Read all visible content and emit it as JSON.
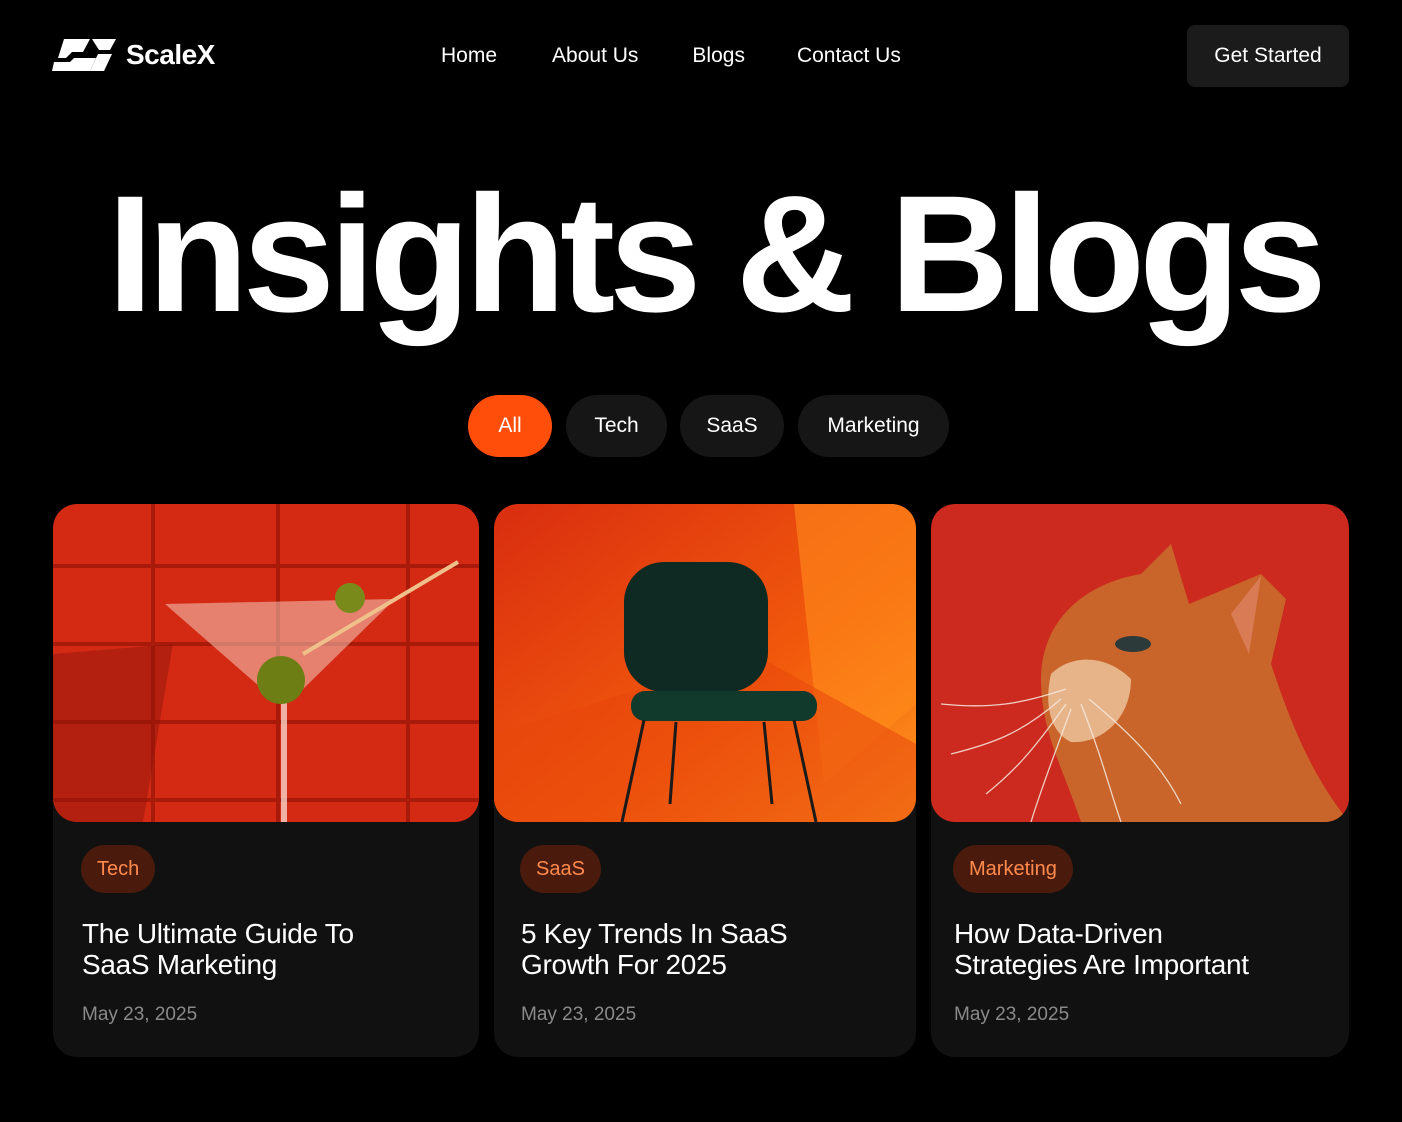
{
  "brand": {
    "name": "ScaleX",
    "logo_icon": "scalex-logo-icon"
  },
  "nav": {
    "items": [
      {
        "label": "Home"
      },
      {
        "label": "About Us"
      },
      {
        "label": "Blogs"
      },
      {
        "label": "Contact Us"
      }
    ],
    "cta_label": "Get Started"
  },
  "hero": {
    "title": "Insights & Blogs"
  },
  "filters": {
    "items": [
      {
        "label": "All",
        "active": true
      },
      {
        "label": "Tech",
        "active": false
      },
      {
        "label": "SaaS",
        "active": false
      },
      {
        "label": "Marketing",
        "active": false
      }
    ]
  },
  "posts": [
    {
      "tag": "Tech",
      "title_line1": "The Ultimate Guide To",
      "title_line2": "SaaS Marketing",
      "date": "May 23, 2025",
      "image": "martini-glass-image"
    },
    {
      "tag": "SaaS",
      "title_line1": "5 Key Trends In SaaS",
      "title_line2": "Growth For 2025",
      "date": "May 23, 2025",
      "image": "green-chair-image"
    },
    {
      "tag": "Marketing",
      "title_line1": "How Data-Driven",
      "title_line2": "Strategies Are Important",
      "date": "May 23, 2025",
      "image": "orange-cat-image"
    }
  ],
  "colors": {
    "background": "#000000",
    "accent": "#ff4d0a",
    "chip": "#161616",
    "card": "#111111",
    "tag_bg": "#4a1b0d",
    "tag_text": "#ff8a4c",
    "date_text": "#8a8a8a"
  }
}
